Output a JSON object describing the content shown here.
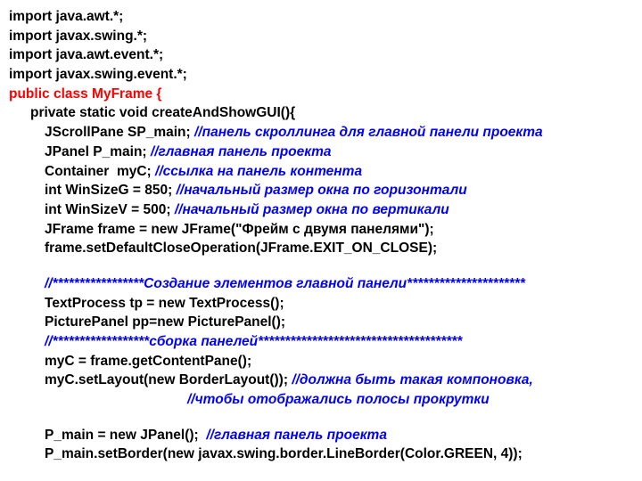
{
  "lines": {
    "imp1": "import java.awt.*;",
    "imp2": "import javax.swing.*;",
    "imp3": "import java.awt.event.*;",
    "imp4": "import javax.swing.event.*;",
    "classdecl": "public class MyFrame {",
    "method": "private static void createAndShowGUI(){",
    "l1a": "JScrollPane SP_main; ",
    "l1b": "//панель скроллинга для главной панели проекта",
    "l2a": "JPanel P_main; ",
    "l2b": "//главная панель проекта",
    "l3a": "Container  myC; ",
    "l3b": "//ссылка на панель контента",
    "l4a": "int WinSizeG = 850; ",
    "l4b": "//начальный размер окна по горизонтали",
    "l5a": "int WinSizeV = 500; ",
    "l5b": "//начальный размер окна по вертикали",
    "l6": "JFrame frame = new JFrame(\"Фрейм с двумя панелями\");",
    "l7": "frame.setDefaultCloseOperation(JFrame.EXIT_ON_CLOSE);",
    "c1a": "//*****************",
    "c1b": "Создание элементов главной панели",
    "c1c": "**********************",
    "l8": "TextProcess tp = new TextProcess();",
    "l9": "PicturePanel pp=new PicturePanel();",
    "c2a": "//******************",
    "c2b": "сборка панелей",
    "c2c": "**************************************",
    "l10": "myC = frame.getContentPane();",
    "l11a": "myC.setLayout(new BorderLayout()); ",
    "l11b": "//должна быть такая компоновка,",
    "l12": "//чтобы отображались полосы прокрутки",
    "l13a": "P_main = new JPanel();  ",
    "l13b": "//главная панель проекта",
    "l14": "P_main.setBorder(new javax.swing.border.LineBorder(Color.GREEN, 4));"
  }
}
